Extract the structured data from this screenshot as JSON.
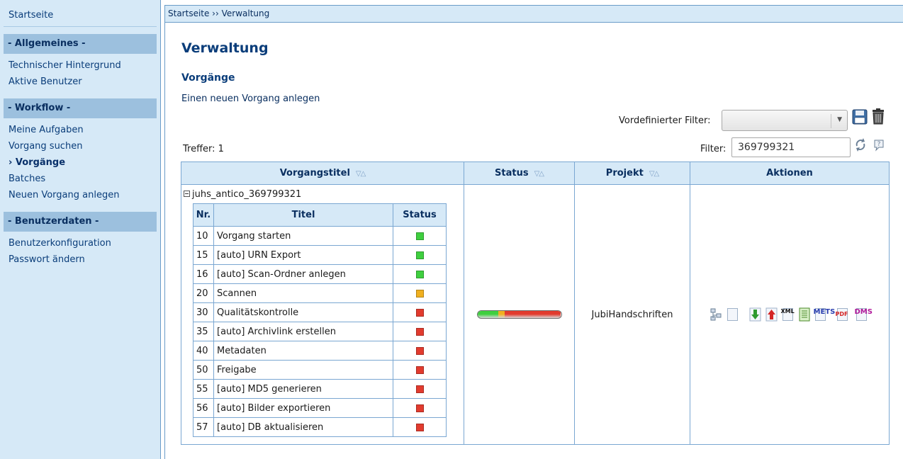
{
  "sidebar": {
    "home": "Startseite",
    "sections": [
      {
        "title": "- Allgemeines -",
        "items": [
          "Technischer Hintergrund",
          "Aktive Benutzer"
        ]
      },
      {
        "title": "- Workflow -",
        "items": [
          "Meine Aufgaben",
          "Vorgang suchen",
          "› Vorgänge",
          "Batches",
          "Neuen Vorgang anlegen"
        ]
      },
      {
        "title": "- Benutzerdaten -",
        "items": [
          "Benutzerkonfiguration",
          "Passwort ändern"
        ]
      }
    ],
    "active_item": "› Vorgänge"
  },
  "breadcrumb": "Startseite ›› Verwaltung",
  "main": {
    "title": "Verwaltung",
    "subtitle": "Vorgänge",
    "new_link": "Einen neuen Vorgang anlegen",
    "predefined_filter_label": "Vordefinierter Filter:",
    "predefined_filter_value": "",
    "hits": "Treffer: 1",
    "filter_label": "Filter:",
    "filter_value": "369799321",
    "columns": {
      "title": "Vorgangstitel",
      "status": "Status",
      "project": "Projekt",
      "actions": "Aktionen"
    },
    "process": {
      "name": "juhs_antico_369799321",
      "project": "JubiHandschriften",
      "progress": {
        "done": 0.25,
        "in_work": 0.08,
        "open": 0.67
      },
      "step_columns": {
        "nr": "Nr.",
        "title": "Titel",
        "status": "Status"
      },
      "steps": [
        {
          "nr": "10",
          "title": "Vorgang starten",
          "status": "done"
        },
        {
          "nr": "15",
          "title": "[auto] URN Export",
          "status": "done"
        },
        {
          "nr": "16",
          "title": "[auto] Scan-Ordner anlegen",
          "status": "done"
        },
        {
          "nr": "20",
          "title": "Scannen",
          "status": "in_work"
        },
        {
          "nr": "30",
          "title": "Qualitätskontrolle",
          "status": "open"
        },
        {
          "nr": "35",
          "title": "[auto] Archivlink erstellen",
          "status": "open"
        },
        {
          "nr": "40",
          "title": "Metadaten",
          "status": "open"
        },
        {
          "nr": "50",
          "title": "Freigabe",
          "status": "open"
        },
        {
          "nr": "55",
          "title": "[auto] MD5 generieren",
          "status": "open"
        },
        {
          "nr": "56",
          "title": "[auto] Bilder exportieren",
          "status": "open"
        },
        {
          "nr": "57",
          "title": "[auto] DB aktualisieren",
          "status": "open"
        }
      ],
      "action_labels": [
        "XML",
        "METS",
        "PDF",
        "DMS"
      ]
    }
  },
  "colors": {
    "done": "#3fcf3f",
    "in_work": "#f0b020",
    "open": "#e23b2e",
    "header_bg": "#d6e9f7",
    "link": "#0a3d7a"
  },
  "icons": {
    "save": "save-icon",
    "delete": "trash-icon",
    "refresh": "refresh-icon",
    "help": "help-icon",
    "expand": "collapse-box-icon",
    "actions": [
      "tree-view-icon",
      "document-icon",
      "download-icon",
      "upload-icon",
      "xml-export-icon",
      "list-doc-icon",
      "mets-export-icon",
      "pdf-export-icon",
      "dms-export-icon"
    ]
  }
}
